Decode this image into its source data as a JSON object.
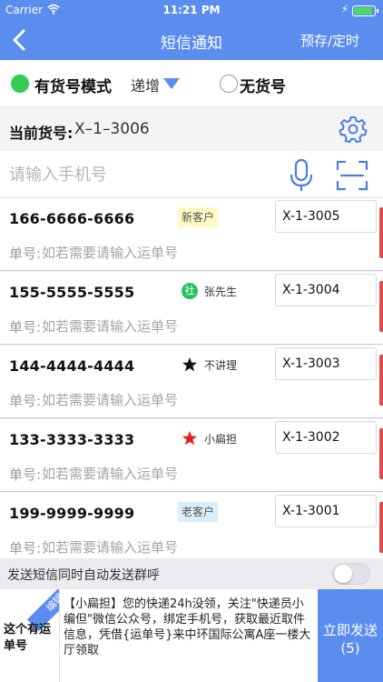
{
  "status_bar": {
    "carrier": "Carrier",
    "time": "11:21 PM"
  },
  "nav": {
    "title": "短信通知",
    "right_label": "预存/定时"
  },
  "modes": {
    "with_code": "有货号模式",
    "increment": "递增",
    "without_code": "无货号",
    "selected": "有货号模式"
  },
  "current_code": {
    "label": "当前货号:",
    "value": "X–1–3006"
  },
  "phone_input": {
    "placeholder": "请输入手机号",
    "value": ""
  },
  "tracking": {
    "label": "单号:",
    "placeholder": "如若需要请输入运单号"
  },
  "entries": [
    {
      "phone": "166-6666-6666",
      "tag": "新客户",
      "tag_style": "yellow",
      "mark": "none",
      "code": "X-1-3005"
    },
    {
      "phone": "155-5555-5555",
      "tag": "张先生",
      "tag_style": "none",
      "mark": "社",
      "code": "X-1-3004"
    },
    {
      "phone": "144-4444-4444",
      "tag": "不讲理",
      "tag_style": "none",
      "mark": "black-star",
      "code": "X-1-3003"
    },
    {
      "phone": "133-3333-3333",
      "tag": "小扁担",
      "tag_style": "none",
      "mark": "red-star",
      "code": "X-1-3002"
    },
    {
      "phone": "199-9999-9999",
      "tag": "老客户",
      "tag_style": "blue",
      "mark": "none",
      "code": "X-1-3001"
    }
  ],
  "auto_call": {
    "text": "发送短信同时自动发送群呼",
    "enabled": false
  },
  "template": {
    "ribbon": "编辑",
    "name": "这个有运单号",
    "content": "【小扁担】您的快递24h没领，关注\"快递员小编但\"微信公众号，绑定手机号，获取最近取件信息，凭借{运单号}来中环国际公寓A座一楼大厅领取"
  },
  "send": {
    "label": "立即发送",
    "count": "(5)"
  },
  "colors": {
    "primary": "#5b8def",
    "radio_on": "#33cc55",
    "alert": "#e24a4a",
    "star_red": "#e02020"
  }
}
